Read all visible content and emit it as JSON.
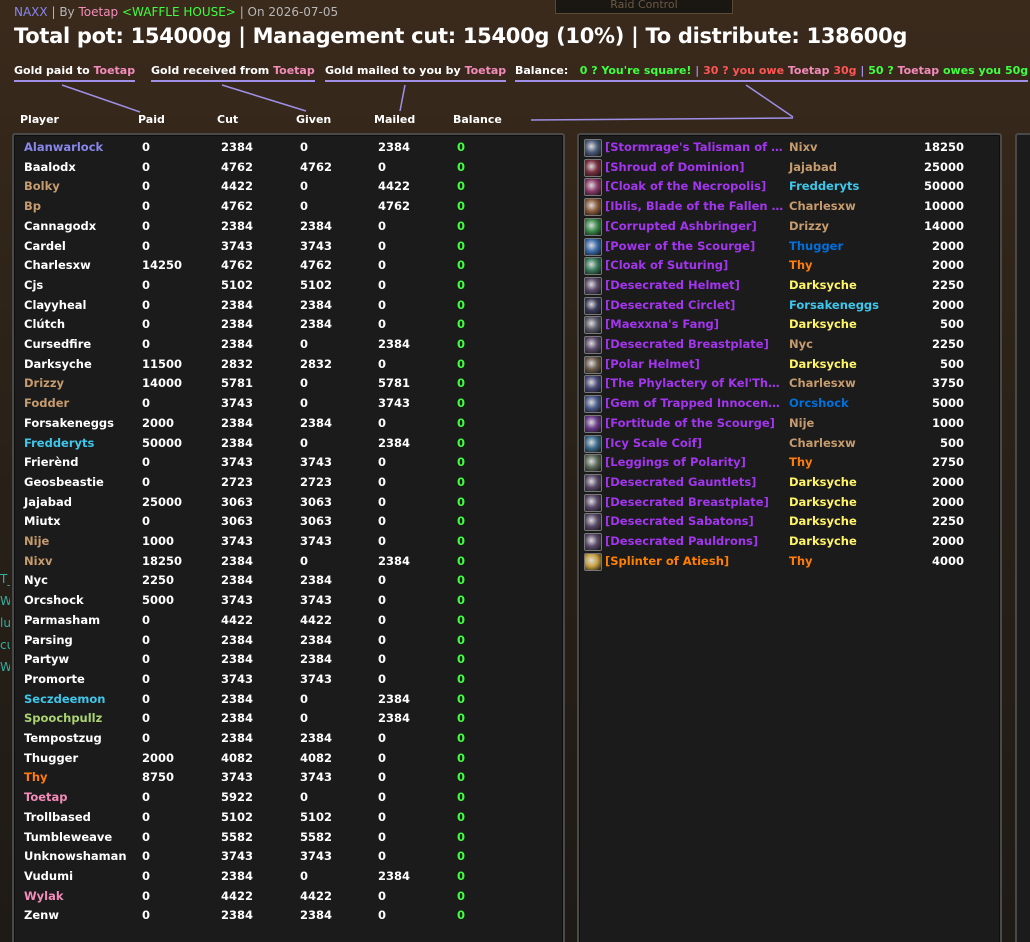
{
  "bg_title": "Raid Control",
  "header": {
    "raid": "NAXX",
    "sep1": " | By ",
    "author": "Toetap",
    "guild": "<WAFFLE HOUSE>",
    "sep2": " | On ",
    "date": "2026-07-05",
    "title": "Total pot: 154000g | Management cut: 15400g (10%) | To distribute: 138600g"
  },
  "legend": {
    "paid_prefix": "Gold paid to ",
    "received_prefix": "Gold received from ",
    "mailed_prefix": "Gold mailed to you by ",
    "who": "Toetap",
    "balance_label": "Balance:",
    "square": "0 ? You're square!",
    "bar1": " | ",
    "owe_pre": "30 ? you owe ",
    "owe_amt": " 30g",
    "bar2": " | ",
    "owes_pre": "50 ? ",
    "owes_post": " owes you 50g"
  },
  "columns": {
    "player": "Player",
    "paid": "Paid",
    "cut": "Cut",
    "given": "Given",
    "mailed": "Mailed",
    "balance": "Balance"
  },
  "colors": {
    "warlock": "#8787ed",
    "white": "#ffffff",
    "warrior": "#c69b6d",
    "mage": "#3fc7eb",
    "paladin": "#f48cba",
    "hunter": "#aad372",
    "rogue": "#fff468",
    "druid": "#ff7c0a",
    "shaman": "#0070dd",
    "epic": "#a335ee",
    "legendary": "#ff8000",
    "positive": "#40ff40"
  },
  "players": [
    {
      "name": "Alanwarlock",
      "color": "warlock",
      "paid": "0",
      "cut": "2384",
      "given": "0",
      "mailed": "2384",
      "balance": "0"
    },
    {
      "name": "Baalodx",
      "color": "white",
      "paid": "0",
      "cut": "4762",
      "given": "4762",
      "mailed": "0",
      "balance": "0"
    },
    {
      "name": "Bolky",
      "color": "warrior",
      "paid": "0",
      "cut": "4422",
      "given": "0",
      "mailed": "4422",
      "balance": "0"
    },
    {
      "name": "Bp",
      "color": "warrior",
      "paid": "0",
      "cut": "4762",
      "given": "0",
      "mailed": "4762",
      "balance": "0"
    },
    {
      "name": "Cannagodx",
      "color": "white",
      "paid": "0",
      "cut": "2384",
      "given": "2384",
      "mailed": "0",
      "balance": "0"
    },
    {
      "name": "Cardel",
      "color": "white",
      "paid": "0",
      "cut": "3743",
      "given": "3743",
      "mailed": "0",
      "balance": "0"
    },
    {
      "name": "Charlesxw",
      "color": "white",
      "paid": "14250",
      "cut": "4762",
      "given": "4762",
      "mailed": "0",
      "balance": "0"
    },
    {
      "name": "Cjs",
      "color": "white",
      "paid": "0",
      "cut": "5102",
      "given": "5102",
      "mailed": "0",
      "balance": "0"
    },
    {
      "name": "Clayyheal",
      "color": "white",
      "paid": "0",
      "cut": "2384",
      "given": "2384",
      "mailed": "0",
      "balance": "0"
    },
    {
      "name": "Clútch",
      "color": "white",
      "paid": "0",
      "cut": "2384",
      "given": "2384",
      "mailed": "0",
      "balance": "0"
    },
    {
      "name": "Cursedfire",
      "color": "white",
      "paid": "0",
      "cut": "2384",
      "given": "0",
      "mailed": "2384",
      "balance": "0"
    },
    {
      "name": "Darksyche",
      "color": "white",
      "paid": "11500",
      "cut": "2832",
      "given": "2832",
      "mailed": "0",
      "balance": "0"
    },
    {
      "name": "Drizzy",
      "color": "warrior",
      "paid": "14000",
      "cut": "5781",
      "given": "0",
      "mailed": "5781",
      "balance": "0"
    },
    {
      "name": "Fodder",
      "color": "warrior",
      "paid": "0",
      "cut": "3743",
      "given": "0",
      "mailed": "3743",
      "balance": "0"
    },
    {
      "name": "Forsakeneggs",
      "color": "white",
      "paid": "2000",
      "cut": "2384",
      "given": "2384",
      "mailed": "0",
      "balance": "0"
    },
    {
      "name": "Fredderyts",
      "color": "mage",
      "paid": "50000",
      "cut": "2384",
      "given": "0",
      "mailed": "2384",
      "balance": "0"
    },
    {
      "name": "Frierènd",
      "color": "white",
      "paid": "0",
      "cut": "3743",
      "given": "3743",
      "mailed": "0",
      "balance": "0"
    },
    {
      "name": "Geosbeastie",
      "color": "white",
      "paid": "0",
      "cut": "2723",
      "given": "2723",
      "mailed": "0",
      "balance": "0"
    },
    {
      "name": "Jajabad",
      "color": "white",
      "paid": "25000",
      "cut": "3063",
      "given": "3063",
      "mailed": "0",
      "balance": "0"
    },
    {
      "name": "Miutx",
      "color": "white",
      "paid": "0",
      "cut": "3063",
      "given": "3063",
      "mailed": "0",
      "balance": "0"
    },
    {
      "name": "Nije",
      "color": "warrior",
      "paid": "1000",
      "cut": "3743",
      "given": "3743",
      "mailed": "0",
      "balance": "0"
    },
    {
      "name": "Nixv",
      "color": "warrior",
      "paid": "18250",
      "cut": "2384",
      "given": "0",
      "mailed": "2384",
      "balance": "0"
    },
    {
      "name": "Nyc",
      "color": "white",
      "paid": "2250",
      "cut": "2384",
      "given": "2384",
      "mailed": "0",
      "balance": "0"
    },
    {
      "name": "Orcshock",
      "color": "white",
      "paid": "5000",
      "cut": "3743",
      "given": "3743",
      "mailed": "0",
      "balance": "0"
    },
    {
      "name": "Parmasham",
      "color": "white",
      "paid": "0",
      "cut": "4422",
      "given": "4422",
      "mailed": "0",
      "balance": "0"
    },
    {
      "name": "Parsing",
      "color": "white",
      "paid": "0",
      "cut": "2384",
      "given": "2384",
      "mailed": "0",
      "balance": "0"
    },
    {
      "name": "Partyw",
      "color": "white",
      "paid": "0",
      "cut": "2384",
      "given": "2384",
      "mailed": "0",
      "balance": "0"
    },
    {
      "name": "Promorte",
      "color": "white",
      "paid": "0",
      "cut": "3743",
      "given": "3743",
      "mailed": "0",
      "balance": "0"
    },
    {
      "name": "Seczdeemon",
      "color": "mage",
      "paid": "0",
      "cut": "2384",
      "given": "0",
      "mailed": "2384",
      "balance": "0"
    },
    {
      "name": "Spoochpullz",
      "color": "hunter",
      "paid": "0",
      "cut": "2384",
      "given": "0",
      "mailed": "2384",
      "balance": "0"
    },
    {
      "name": "Tempostzug",
      "color": "white",
      "paid": "0",
      "cut": "2384",
      "given": "2384",
      "mailed": "0",
      "balance": "0"
    },
    {
      "name": "Thugger",
      "color": "white",
      "paid": "2000",
      "cut": "4082",
      "given": "4082",
      "mailed": "0",
      "balance": "0"
    },
    {
      "name": "Thy",
      "color": "druid",
      "paid": "8750",
      "cut": "3743",
      "given": "3743",
      "mailed": "0",
      "balance": "0"
    },
    {
      "name": "Toetap",
      "color": "paladin",
      "paid": "0",
      "cut": "5922",
      "given": "0",
      "mailed": "0",
      "balance": "0"
    },
    {
      "name": "Trollbased",
      "color": "white",
      "paid": "0",
      "cut": "5102",
      "given": "5102",
      "mailed": "0",
      "balance": "0"
    },
    {
      "name": "Tumbleweave",
      "color": "white",
      "paid": "0",
      "cut": "5582",
      "given": "5582",
      "mailed": "0",
      "balance": "0"
    },
    {
      "name": "Unknowshaman",
      "color": "white",
      "paid": "0",
      "cut": "3743",
      "given": "3743",
      "mailed": "0",
      "balance": "0"
    },
    {
      "name": "Vudumi",
      "color": "white",
      "paid": "0",
      "cut": "2384",
      "given": "0",
      "mailed": "2384",
      "balance": "0"
    },
    {
      "name": "Wylak",
      "color": "paladin",
      "paid": "0",
      "cut": "4422",
      "given": "4422",
      "mailed": "0",
      "balance": "0"
    },
    {
      "name": "Zenw",
      "color": "white",
      "paid": "0",
      "cut": "2384",
      "given": "2384",
      "mailed": "0",
      "balance": "0"
    }
  ],
  "loot": [
    {
      "item": "[Stormrage's Talisman of Seet…",
      "rarity": "epic",
      "icon": "talisman-icon",
      "icon_color": "#4a5a78",
      "winner": "Nixv",
      "winner_color": "warrior",
      "amount": "18250"
    },
    {
      "item": "[Shroud of Dominion]",
      "rarity": "epic",
      "icon": "cloak-icon",
      "icon_color": "#7a3040",
      "winner": "Jajabad",
      "winner_color": "warrior",
      "amount": "25000"
    },
    {
      "item": "[Cloak of the Necropolis]",
      "rarity": "epic",
      "icon": "cloak-icon",
      "icon_color": "#8a3a6a",
      "winner": "Fredderyts",
      "winner_color": "mage",
      "amount": "50000"
    },
    {
      "item": "[Iblis, Blade of the Fallen Sera…",
      "rarity": "epic",
      "icon": "sword-icon",
      "icon_color": "#8a5a3a",
      "winner": "Charlesxw",
      "winner_color": "warrior",
      "amount": "10000"
    },
    {
      "item": "[Corrupted Ashbringer]",
      "rarity": "epic",
      "icon": "sword-icon",
      "icon_color": "#3a8a4a",
      "winner": "Drizzy",
      "winner_color": "warrior",
      "amount": "14000"
    },
    {
      "item": "[Power of the Scourge]",
      "rarity": "epic",
      "icon": "orb-icon",
      "icon_color": "#3a6aaa",
      "winner": "Thugger",
      "winner_color": "shaman",
      "amount": "2000"
    },
    {
      "item": "[Cloak of Suturing]",
      "rarity": "epic",
      "icon": "cloak-icon",
      "icon_color": "#3a7a5a",
      "winner": "Thy",
      "winner_color": "druid",
      "amount": "2000"
    },
    {
      "item": "[Desecrated Helmet]",
      "rarity": "epic",
      "icon": "helmet-icon",
      "icon_color": "#5a4a6a",
      "winner": "Darksyche",
      "winner_color": "rogue",
      "amount": "2250"
    },
    {
      "item": "[Desecrated Circlet]",
      "rarity": "epic",
      "icon": "circlet-icon",
      "icon_color": "#3a3a5a",
      "winner": "Forsakeneggs",
      "winner_color": "mage",
      "amount": "2000"
    },
    {
      "item": "[Maexxna's Fang]",
      "rarity": "epic",
      "icon": "dagger-icon",
      "icon_color": "#5a5a6a",
      "winner": "Darksyche",
      "winner_color": "rogue",
      "amount": "500"
    },
    {
      "item": "[Desecrated Breastplate]",
      "rarity": "epic",
      "icon": "breastplate-icon",
      "icon_color": "#5a4a6a",
      "winner": "Nyc",
      "winner_color": "warrior",
      "amount": "2250"
    },
    {
      "item": "[Polar Helmet]",
      "rarity": "epic",
      "icon": "helmet-icon",
      "icon_color": "#6a5a4a",
      "winner": "Darksyche",
      "winner_color": "rogue",
      "amount": "500"
    },
    {
      "item": "[The Phylactery of Kel'Thuzad]",
      "rarity": "epic",
      "icon": "phylactery-icon",
      "icon_color": "#4a4a7a",
      "winner": "Charlesxw",
      "winner_color": "warrior",
      "amount": "3750"
    },
    {
      "item": "[Gem of Trapped Innocents]",
      "rarity": "epic",
      "icon": "gem-icon",
      "icon_color": "#4a5a8a",
      "winner": "Orcshock",
      "winner_color": "shaman",
      "amount": "5000"
    },
    {
      "item": "[Fortitude of the Scourge]",
      "rarity": "epic",
      "icon": "orb-icon",
      "icon_color": "#6a3a8a",
      "winner": "Nije",
      "winner_color": "warrior",
      "amount": "1000"
    },
    {
      "item": "[Icy Scale Coif]",
      "rarity": "epic",
      "icon": "coif-icon",
      "icon_color": "#3a6a8a",
      "winner": "Charlesxw",
      "winner_color": "warrior",
      "amount": "500"
    },
    {
      "item": "[Leggings of Polarity]",
      "rarity": "epic",
      "icon": "leggings-icon",
      "icon_color": "#5a6a5a",
      "winner": "Thy",
      "winner_color": "druid",
      "amount": "2750"
    },
    {
      "item": "[Desecrated Gauntlets]",
      "rarity": "epic",
      "icon": "gauntlets-icon",
      "icon_color": "#5a4a6a",
      "winner": "Darksyche",
      "winner_color": "rogue",
      "amount": "2000"
    },
    {
      "item": "[Desecrated Breastplate]",
      "rarity": "epic",
      "icon": "breastplate-icon",
      "icon_color": "#5a4a6a",
      "winner": "Darksyche",
      "winner_color": "rogue",
      "amount": "2000"
    },
    {
      "item": "[Desecrated Sabatons]",
      "rarity": "epic",
      "icon": "boots-icon",
      "icon_color": "#5a4a6a",
      "winner": "Darksyche",
      "winner_color": "rogue",
      "amount": "2250"
    },
    {
      "item": "[Desecrated Pauldrons]",
      "rarity": "epic",
      "icon": "pauldrons-icon",
      "icon_color": "#5a4a6a",
      "winner": "Darksyche",
      "winner_color": "rogue",
      "amount": "2000"
    },
    {
      "item": "[Splinter of Atiesh]",
      "rarity": "legendary",
      "icon": "splinter-icon",
      "icon_color": "#c8a040",
      "winner": "Thy",
      "winner_color": "druid",
      "amount": "4000"
    }
  ]
}
